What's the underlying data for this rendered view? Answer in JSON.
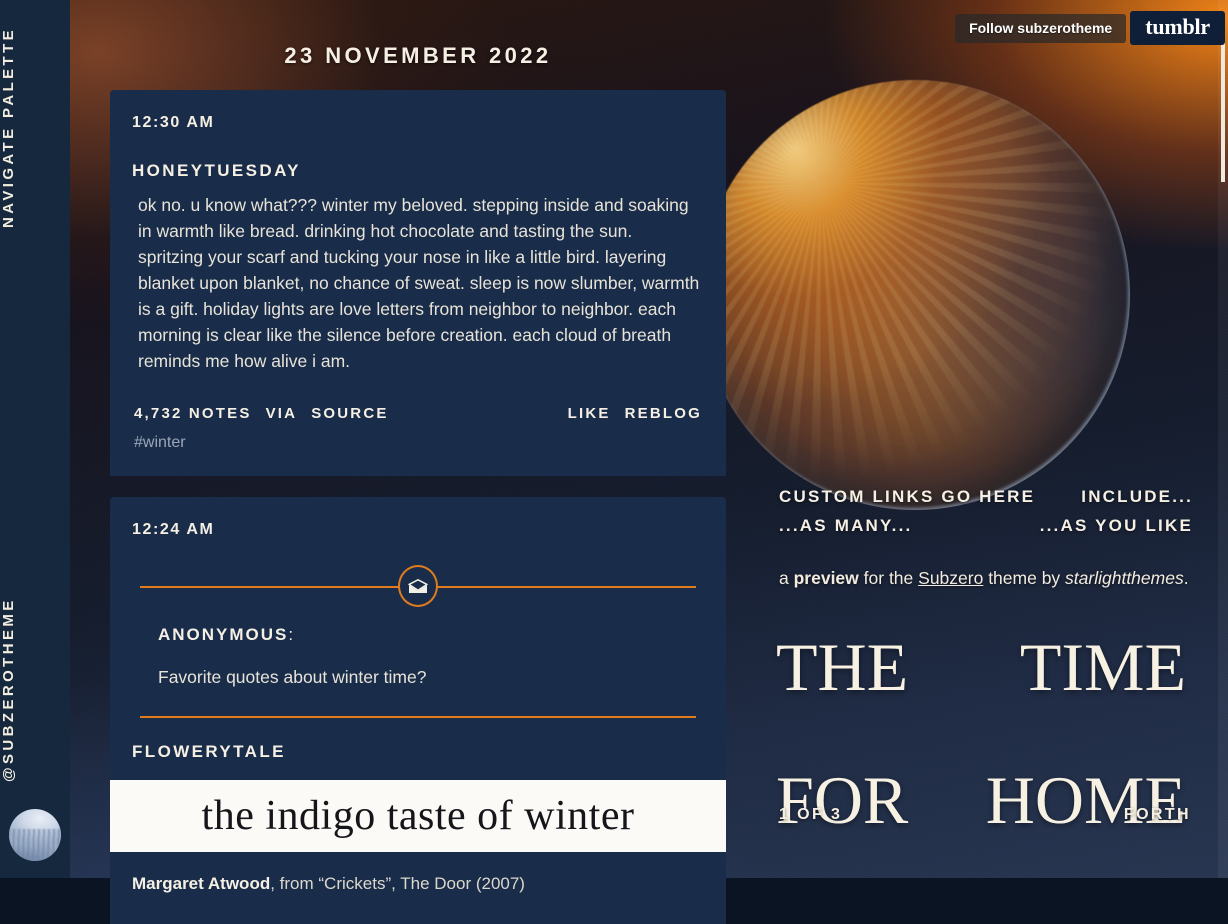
{
  "sidebar": {
    "navigate_label": "NAVIGATE PALETTE",
    "handle": "@SUBZEROTHEME",
    "avatar_name": "avatar"
  },
  "followbar": {
    "follow_label": "Follow subzerotheme",
    "logo_label": "tumblr"
  },
  "feed": {
    "date_header": "23 NOVEMBER 2022",
    "posts": [
      {
        "time": "12:30 AM",
        "author": "HONEYTUESDAY",
        "body": "ok no. u know what??? winter my beloved. stepping inside and soaking in warmth like bread. drinking hot chocolate and tasting the sun. spritzing your scarf and tucking your nose in like a little bird. layering blanket upon blanket, no chance of sweat. sleep is now slumber, warmth is a gift. holiday lights are love letters from neighbor to neighbor. each morning is clear like the silence before creation. each cloud of breath reminds me how alive i am.",
        "notes": "4,732 NOTES",
        "via": "VIA",
        "source": "SOURCE",
        "like": "LIKE",
        "reblog": "REBLOG",
        "tag": "#winter"
      },
      {
        "time": "12:24 AM",
        "asker": "ANONYMOUS",
        "asker_colon": ":",
        "question": "Favorite quotes about winter time?",
        "answer_author": "FLOWERYTALE",
        "quote_image_text": "the indigo taste of winter",
        "source_author": "Margaret Atwood",
        "source_rest": ", from “Crickets”, The Door (2007)"
      }
    ]
  },
  "right": {
    "custom_links": [
      [
        "CUSTOM LINKS GO HERE",
        "INCLUDE..."
      ],
      [
        "...AS MANY...",
        "...AS YOU LIKE"
      ]
    ],
    "description": {
      "a": "a ",
      "preview": "preview",
      "for_the": " for the ",
      "theme_link": "Subzero",
      "theme_by": " theme by ",
      "author": "starlightthemes",
      "period": "."
    },
    "title_line1": "THE TIME",
    "title_line2": "FOR HOME",
    "page_indicator": "1 OF 3",
    "page_next": "FORTH"
  },
  "colors": {
    "accent_orange": "#e07b1e",
    "card_navy": "#192c49",
    "sidebar_navy": "#16283e",
    "cream": "#f6f0e4"
  }
}
